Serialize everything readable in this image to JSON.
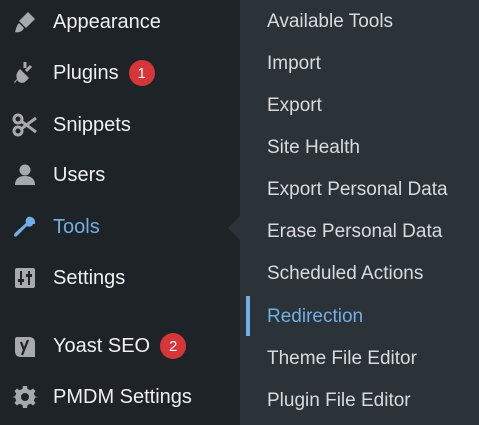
{
  "sidebar": {
    "items": [
      {
        "label": "Appearance",
        "icon": "paintbrush-icon"
      },
      {
        "label": "Plugins",
        "icon": "plug-icon",
        "badge": "1"
      },
      {
        "label": "Snippets",
        "icon": "scissors-icon"
      },
      {
        "label": "Users",
        "icon": "user-icon"
      },
      {
        "label": "Tools",
        "icon": "wrench-icon",
        "current": true
      },
      {
        "label": "Settings",
        "icon": "sliders-icon"
      },
      {
        "label": "Yoast SEO",
        "icon": "yoast-icon",
        "badge": "2"
      },
      {
        "label": "PMDM Settings",
        "icon": "gear-icon"
      }
    ]
  },
  "submenu": {
    "items": [
      {
        "label": "Available Tools"
      },
      {
        "label": "Import"
      },
      {
        "label": "Export"
      },
      {
        "label": "Site Health"
      },
      {
        "label": "Export Personal Data"
      },
      {
        "label": "Erase Personal Data"
      },
      {
        "label": "Scheduled Actions"
      },
      {
        "label": "Redirection",
        "current": true
      },
      {
        "label": "Theme File Editor"
      },
      {
        "label": "Plugin File Editor"
      }
    ]
  },
  "colors": {
    "sidebar_bg": "#1d2327",
    "submenu_bg": "#2c3338",
    "accent": "#72aee6",
    "badge": "#d63638",
    "icon": "#a7aaad"
  }
}
